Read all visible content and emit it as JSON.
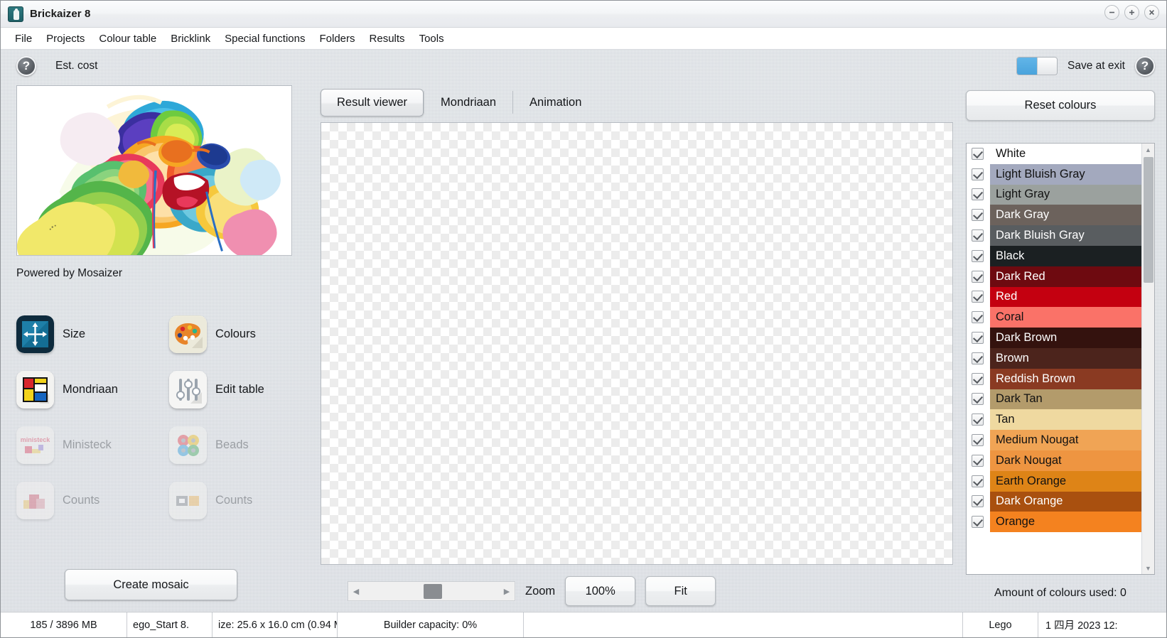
{
  "window": {
    "title": "Brickaizer 8",
    "app_icon": "brickaizer-app-icon",
    "minimize_icon": "minimize-icon",
    "maximize_icon": "maximize-icon",
    "close_icon": "close-icon"
  },
  "menubar": {
    "items": [
      {
        "label": "File"
      },
      {
        "label": "Projects"
      },
      {
        "label": "Colour table"
      },
      {
        "label": "Bricklink"
      },
      {
        "label": "Special functions"
      },
      {
        "label": "Folders"
      },
      {
        "label": "Results"
      },
      {
        "label": "Tools"
      }
    ]
  },
  "toolbar": {
    "help_glyph": "?",
    "est_cost_label": "Est. cost",
    "save_at_exit_label": "Save at exit",
    "toggle_state": "on",
    "toggle_accent": "#4aa3dc",
    "help_right_glyph": "?"
  },
  "left_panel": {
    "preview_caption": "Powered by Mosaizer",
    "tools": [
      {
        "label": "Size",
        "icon": "size-icon",
        "enabled": true
      },
      {
        "label": "Colours",
        "icon": "palette-icon",
        "enabled": true
      },
      {
        "label": "Mondriaan",
        "icon": "mondriaan-icon",
        "enabled": true
      },
      {
        "label": "Edit table",
        "icon": "sliders-icon",
        "enabled": true
      },
      {
        "label": "Ministeck",
        "icon": "ministeck-icon",
        "enabled": false
      },
      {
        "label": "Beads",
        "icon": "beads-icon",
        "enabled": false
      },
      {
        "label": "Counts",
        "icon": "counts-icon",
        "enabled": false
      },
      {
        "label": "Counts",
        "icon": "save-icon",
        "enabled": false
      }
    ],
    "create_mosaic_label": "Create mosaic"
  },
  "center_panel": {
    "tabs": [
      {
        "label": "Result viewer",
        "active": true
      },
      {
        "label": "Mondriaan",
        "active": false
      },
      {
        "label": "Animation",
        "active": false
      }
    ],
    "canvas_state": "empty-transparent-checkerboard",
    "zoom_label": "Zoom",
    "zoom_value": "100%",
    "fit_label": "Fit",
    "scroll_left_glyph": "◀",
    "scroll_right_glyph": "▶"
  },
  "right_panel": {
    "reset_colours_label": "Reset colours",
    "amount_used_label": "Amount of colours used: 0",
    "scroll_up_glyph": "▲",
    "scroll_down_glyph": "▼",
    "colours": [
      {
        "name": "White",
        "hex": "#FFFFFF",
        "text": "#111111",
        "checked": true
      },
      {
        "name": "Light Bluish Gray",
        "hex": "#A3A9BE",
        "text": "#111111",
        "checked": true
      },
      {
        "name": "Light Gray",
        "hex": "#9BA19E",
        "text": "#111111",
        "checked": true
      },
      {
        "name": "Dark Gray",
        "hex": "#6C625C",
        "text": "#FFFFFF",
        "checked": true
      },
      {
        "name": "Dark Bluish Gray",
        "hex": "#595D60",
        "text": "#FFFFFF",
        "checked": true
      },
      {
        "name": "Black",
        "hex": "#1B2022",
        "text": "#FFFFFF",
        "checked": true
      },
      {
        "name": "Dark Red",
        "hex": "#6E0A10",
        "text": "#FFFFFF",
        "checked": true
      },
      {
        "name": "Red",
        "hex": "#C40010",
        "text": "#FFFFFF",
        "checked": true
      },
      {
        "name": "Coral",
        "hex": "#FA7268",
        "text": "#111111",
        "checked": true
      },
      {
        "name": "Dark Brown",
        "hex": "#34120E",
        "text": "#FFFFFF",
        "checked": true
      },
      {
        "name": "Brown",
        "hex": "#4C241C",
        "text": "#FFFFFF",
        "checked": true
      },
      {
        "name": "Reddish Brown",
        "hex": "#8A3A22",
        "text": "#FFFFFF",
        "checked": true
      },
      {
        "name": "Dark Tan",
        "hex": "#B39B6B",
        "text": "#111111",
        "checked": true
      },
      {
        "name": "Tan",
        "hex": "#EFD9A0",
        "text": "#111111",
        "checked": true
      },
      {
        "name": "Medium Nougat",
        "hex": "#F0A455",
        "text": "#111111",
        "checked": true
      },
      {
        "name": "Dark Nougat",
        "hex": "#EE9541",
        "text": "#111111",
        "checked": true
      },
      {
        "name": "Earth Orange",
        "hex": "#DE8417",
        "text": "#111111",
        "checked": true
      },
      {
        "name": "Dark Orange",
        "hex": "#A9500F",
        "text": "#FFFFFF",
        "checked": true
      },
      {
        "name": "Orange",
        "hex": "#F4821F",
        "text": "#111111",
        "checked": true
      }
    ]
  },
  "statusbar": {
    "memory": "185 / 3896 MB",
    "file": "ego_Start 8.",
    "size": "ize: 25.6 x 16.0 cm (0.94 M",
    "builder_capacity": "Builder capacity: 0%",
    "empty": "",
    "brand": "Lego",
    "datetime": "1 四月 2023  12:"
  }
}
